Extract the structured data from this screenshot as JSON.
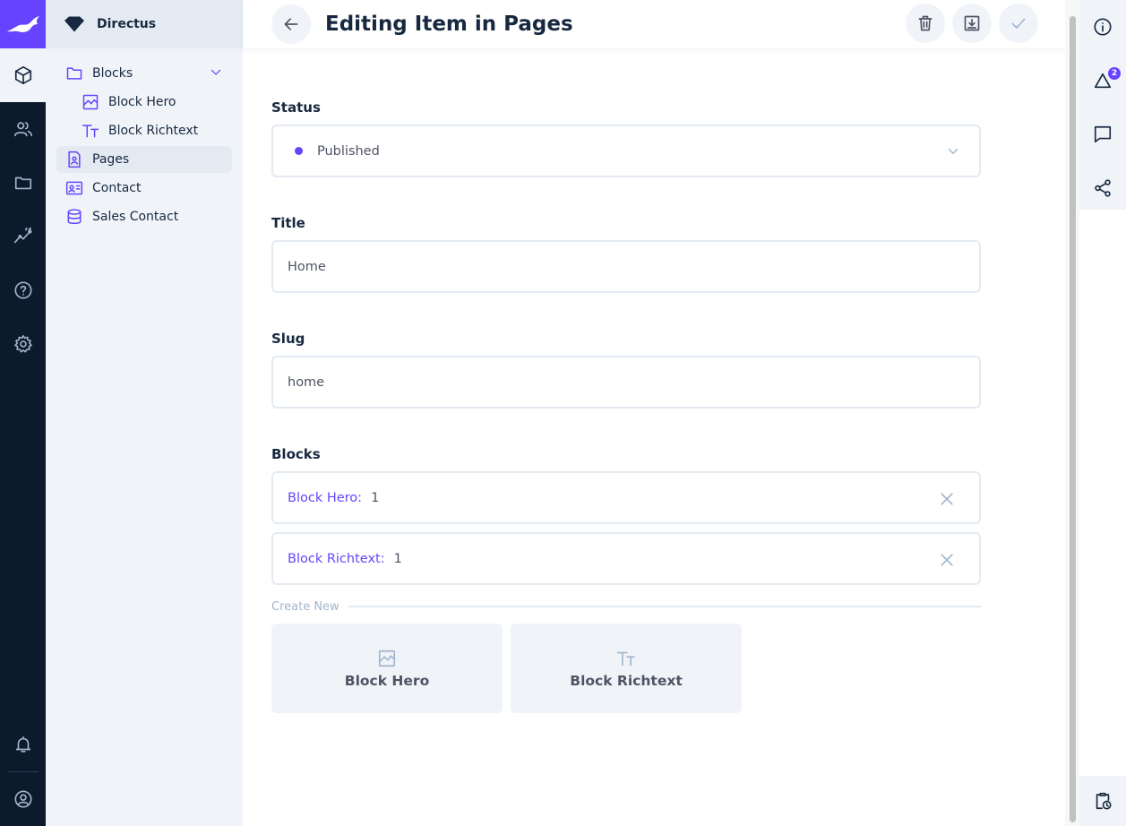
{
  "project": {
    "name": "Directus"
  },
  "modules": [
    {
      "name": "content",
      "icon": "cube-icon",
      "active": true
    },
    {
      "name": "user-directory",
      "icon": "users-icon"
    },
    {
      "name": "file-library",
      "icon": "folder-icon"
    },
    {
      "name": "insights",
      "icon": "insights-icon"
    },
    {
      "name": "help",
      "icon": "help-icon"
    },
    {
      "name": "settings",
      "icon": "gear-icon"
    }
  ],
  "nav": {
    "items": [
      {
        "label": "Blocks",
        "icon": "folder-icon",
        "expanded": true
      },
      {
        "label": "Block Hero",
        "icon": "image-icon",
        "child": true
      },
      {
        "label": "Block Richtext",
        "icon": "text-format-icon",
        "child": true
      },
      {
        "label": "Pages",
        "icon": "page-icon",
        "active": true
      },
      {
        "label": "Contact",
        "icon": "contact-card-icon"
      },
      {
        "label": "Sales Contact",
        "icon": "database-icon"
      }
    ]
  },
  "header": {
    "title": "Editing Item in Pages"
  },
  "form": {
    "status": {
      "label": "Status",
      "value": "Published"
    },
    "title": {
      "label": "Title",
      "value": "Home"
    },
    "slug": {
      "label": "Slug",
      "value": "home"
    },
    "blocks": {
      "label": "Blocks",
      "items": [
        {
          "type": "Block Hero:",
          "value": "1"
        },
        {
          "type": "Block Richtext:",
          "value": "1"
        }
      ],
      "create_new_label": "Create New",
      "create_options": [
        "Block Hero",
        "Block Richtext"
      ]
    }
  },
  "right_sidebar": {
    "notifications_count": "2"
  },
  "colors": {
    "accent": "#6644ff",
    "dark": "#0c1a2c",
    "nav_bg": "#f0f4f9"
  }
}
